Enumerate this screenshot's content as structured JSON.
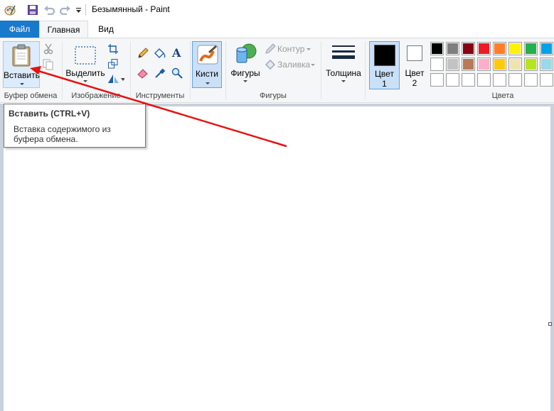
{
  "window": {
    "title": "Безымянный - Paint"
  },
  "quick_access": {
    "icons": [
      "paint-app-icon",
      "save-icon",
      "undo-icon",
      "redo-icon",
      "customize-qat-icon"
    ]
  },
  "tabs": [
    {
      "label": "Файл"
    },
    {
      "label": "Главная"
    },
    {
      "label": "Вид"
    }
  ],
  "ribbon": {
    "clipboard": {
      "group_label": "Буфер обмена",
      "paste_label": "Вставить"
    },
    "image": {
      "group_label": "Изображение",
      "select_label": "Выделить"
    },
    "tools": {
      "group_label": "Инструменты"
    },
    "brushes": {
      "label": "Кисти"
    },
    "shapes": {
      "group_label": "Фигуры",
      "shapes_label": "Фигуры",
      "outline_label": "Контур",
      "fill_label": "Заливка"
    },
    "size": {
      "label": "Толщина"
    },
    "colors": {
      "group_label": "Цвета",
      "color1_label": "Цвет",
      "color1_num": "1",
      "color2_label": "Цвет",
      "color2_num": "2",
      "color1_value": "#000000",
      "color2_value": "#ffffff",
      "palette_row1": [
        "#000000",
        "#7f7f7f",
        "#880015",
        "#ed1c24",
        "#ff7f27",
        "#fff200",
        "#22b14c",
        "#00a2e8"
      ],
      "palette_row2": [
        "#ffffff",
        "#c3c3c3",
        "#b97a57",
        "#ffaec9",
        "#ffc90e",
        "#efe4b0",
        "#b5e61d",
        "#99d9ea"
      ],
      "palette_row3": [
        "#ffffff",
        "#ffffff",
        "#ffffff",
        "#ffffff",
        "#ffffff",
        "#ffffff",
        "#ffffff",
        "#ffffff"
      ]
    }
  },
  "tooltip": {
    "title": "Вставить (CTRL+V)",
    "description": "Вставка содержимого из буфера обмена."
  },
  "annotation": {
    "arrow_color": "#e81010"
  }
}
